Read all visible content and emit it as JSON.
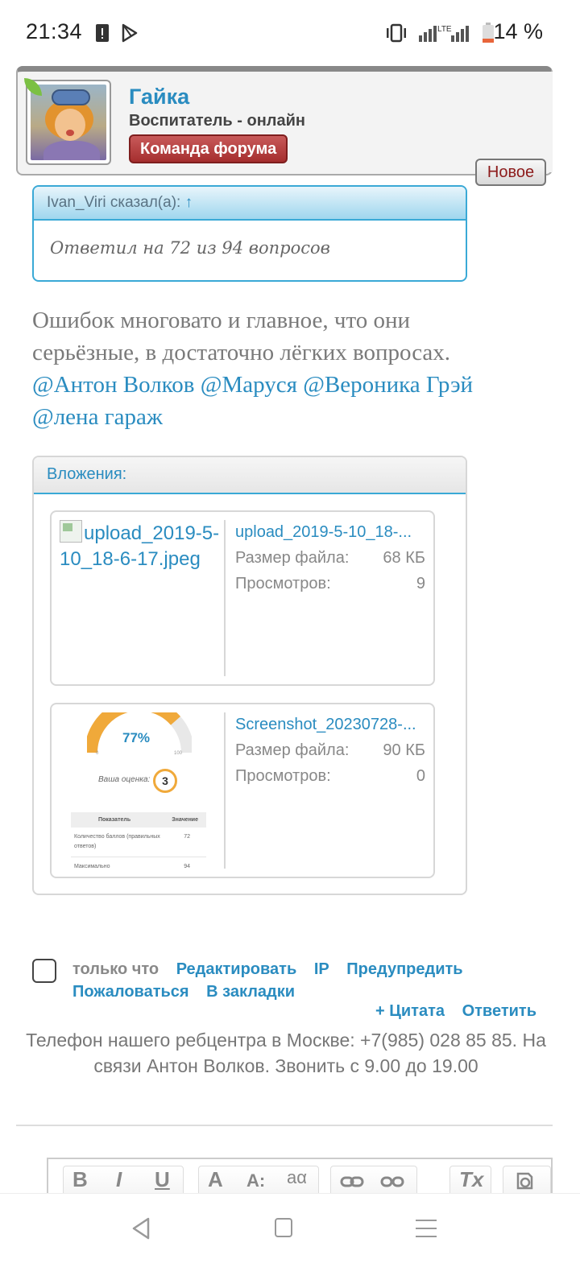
{
  "status_bar": {
    "time": "21:34",
    "battery_percent": "14 %",
    "network_label": "LTE",
    "icons": [
      "warning-icon",
      "play-store-icon",
      "vibrate-icon",
      "signal-icon",
      "battery-icon"
    ]
  },
  "profile": {
    "name": "Гайка",
    "title": "Воспитатель - онлайн",
    "badge": "Команда форума",
    "new_label": "Новое"
  },
  "quote": {
    "author": "Ivan_Viri сказал(а):",
    "arrow": "↑",
    "text": "Ответил на 72 из 94 вопросов"
  },
  "message": {
    "text": "Ошибок многовато и главное, что они серьёзные, в достаточно лёгких вопросах.",
    "mentions": [
      "@Антон Волков",
      "@Маруся",
      "@Вероника Грэй",
      "@лена гараж"
    ]
  },
  "attachments": {
    "header": "Вложения:",
    "items": [
      {
        "thumb_alt": "upload_2019-5-10_18-6-17.jpeg",
        "filename": "upload_2019-5-10_18-...",
        "size_label": "Размер файла:",
        "size_value": "68 КБ",
        "views_label": "Просмотров:",
        "views_value": "9"
      },
      {
        "filename": "Screenshot_20230728-...",
        "size_label": "Размер файла:",
        "size_value": "90 КБ",
        "views_label": "Просмотров:",
        "views_value": "0",
        "preview": {
          "percent": "77%",
          "gauge_fill": 0.77,
          "min": "0",
          "max": "100",
          "score_label": "Ваша оценка:",
          "score": "3",
          "table_headers": [
            "Показатель",
            "Значение"
          ],
          "row1_label": "Количество баллов (правильных ответов)",
          "row1_value": "72",
          "row2_label": "Максимально",
          "row2_value": "94"
        }
      }
    ]
  },
  "post_footer": {
    "time": "только что",
    "edit": "Редактировать",
    "ip": "IP",
    "warn": "Предупредить",
    "report": "Пожаловаться",
    "bookmark": "В закладки",
    "quote": "+ Цитата",
    "reply": "Ответить"
  },
  "signature": "Телефон нашего ребцентра в Москве: +7(985) 028 85 85. На связи Антон Волков. Звонить с 9.00 до 19.00",
  "editor_toolbar": {
    "bold": "B",
    "italic": "I",
    "underline": "U",
    "font_size": "A",
    "font_size_small": "A:",
    "font_family": "aα",
    "link": "link-icon",
    "unlink": "unlink-icon",
    "clear_format": "Tx",
    "restore": "restore-icon"
  },
  "colors": {
    "accent": "#2a8cc0",
    "badge": "#a52e2e",
    "text_gray": "#777777"
  }
}
